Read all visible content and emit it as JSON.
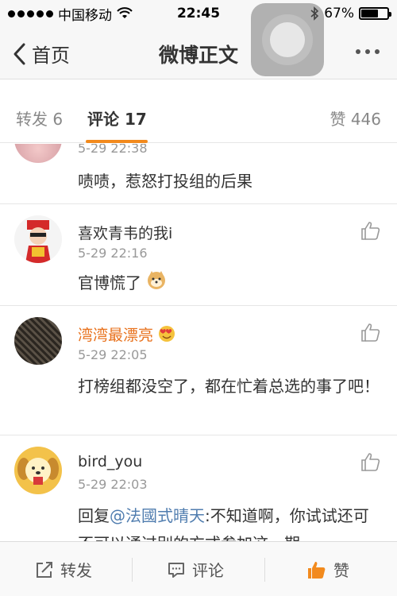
{
  "status": {
    "carrier": "中国移动",
    "time": "22:45",
    "battery": "67%",
    "battery_level": 0.67
  },
  "nav": {
    "back_label": "首页",
    "title": "微博正文"
  },
  "tabs": [
    {
      "label": "转发 6"
    },
    {
      "label": "评论 17"
    },
    {
      "label": "赞 446"
    }
  ],
  "comments": [
    {
      "name": "",
      "time": "5-29 22:38",
      "text": "啧啧，惹怒打投组的后果"
    },
    {
      "name": "喜欢青韦的我i",
      "time": "5-29 22:16",
      "text": "官博慌了"
    },
    {
      "name": "湾湾最漂亮",
      "time": "5-29 22:05",
      "text": "打榜组都没空了，都在忙着总选的事了吧！"
    },
    {
      "name": "bird_you",
      "time": "5-29 22:03",
      "reply_prefix": "回复",
      "mention": "@法國式晴天",
      "text": ":不知道啊，你试试还可不可以通过别的方式参加这一期"
    }
  ],
  "bottom": {
    "repost": "转发",
    "comment": "评论",
    "like": "赞"
  },
  "colors": {
    "accent": "#f28a1d",
    "mention": "#507daf",
    "orange_name": "#e8711c"
  }
}
